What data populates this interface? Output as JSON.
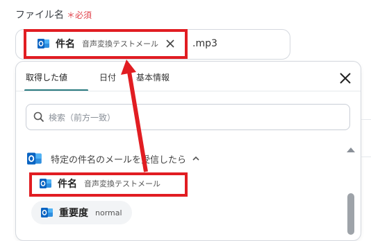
{
  "field": {
    "label": "ファイル名",
    "required_mark": "＊",
    "required_text": "必須"
  },
  "input": {
    "chip": {
      "name": "件名",
      "value": "音声変換テストメール"
    },
    "suffix": ".mp3"
  },
  "dropdown": {
    "tabs": [
      {
        "label": "取得した値",
        "active": true
      },
      {
        "label": "日付",
        "active": false
      },
      {
        "label": "基本情報",
        "active": false
      }
    ],
    "search_placeholder": "検索（前方一致）",
    "group": {
      "title": "特定の件名のメールを受信したら"
    },
    "items": [
      {
        "name": "件名",
        "value": "音声変換テストメール"
      },
      {
        "name": "重要度",
        "value": "normal"
      }
    ]
  },
  "colors": {
    "accent": "#2a7b80",
    "highlight": "#e11d22",
    "required": "#e0424b",
    "outlook_blue": "#0a64c2"
  },
  "icons": [
    "outlook-icon",
    "close-icon",
    "search-icon",
    "chevron-up-icon",
    "scroll-up-icon"
  ]
}
